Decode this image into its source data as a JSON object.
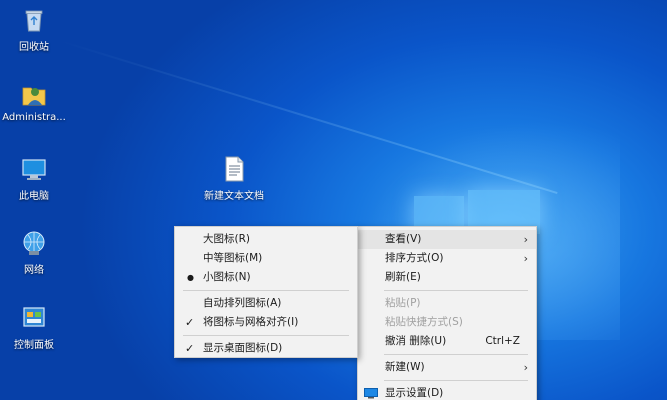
{
  "desktop_icons": [
    {
      "label": "回收站",
      "icon": "recycle-bin-icon"
    },
    {
      "label": "Administra...",
      "icon": "user-folder-icon"
    },
    {
      "label": "此电脑",
      "icon": "computer-icon"
    },
    {
      "label": "网络",
      "icon": "network-icon"
    },
    {
      "label": "控制面板",
      "icon": "control-panel-icon"
    },
    {
      "label": "新建文本文档",
      "icon": "text-document-icon"
    }
  ],
  "context_menu": {
    "view": "查看(V)",
    "sort": "排序方式(O)",
    "refresh": "刷新(E)",
    "paste": "粘贴(P)",
    "paste_shortcut": "粘贴快捷方式(S)",
    "undo": "撤消 删除(U)",
    "undo_shortcut": "Ctrl+Z",
    "new": "新建(W)",
    "display_settings": "显示设置(D)"
  },
  "view_submenu": {
    "large_icons": "大图标(R)",
    "medium_icons": "中等图标(M)",
    "small_icons": "小图标(N)",
    "auto_arrange": "自动排列图标(A)",
    "align_grid": "将图标与网格对齐(I)",
    "show_icons": "显示桌面图标(D)",
    "selected_mark": "●",
    "check_mark": "✓"
  },
  "colors": {
    "accent": "#0a55c9",
    "menu_bg": "#f2f2f2",
    "hover": "#e4e4e4",
    "disabled": "#a0a0a0"
  }
}
